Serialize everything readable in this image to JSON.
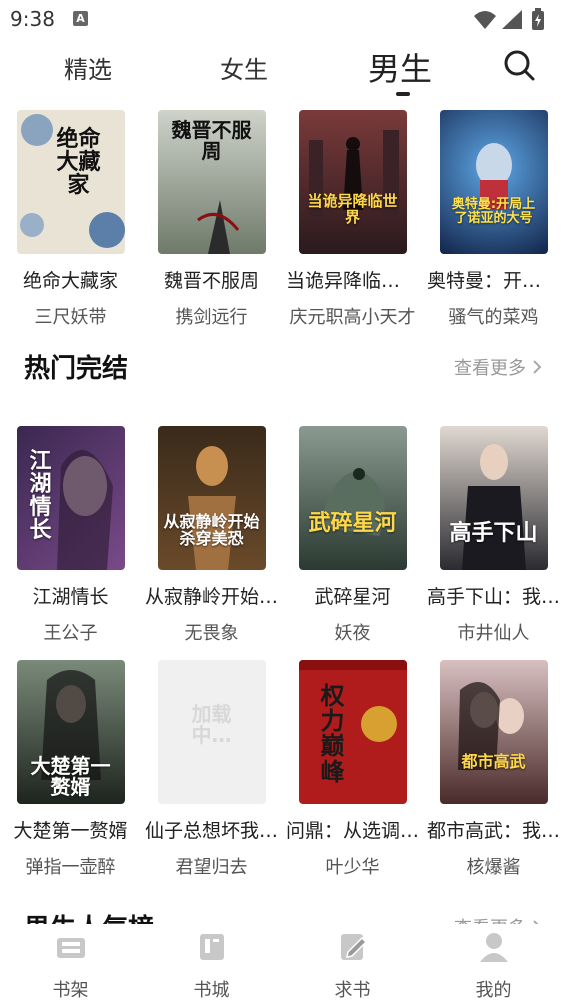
{
  "status_bar": {
    "time": "9:38",
    "notification_icon": "A"
  },
  "top_tabs": [
    {
      "label": "精选"
    },
    {
      "label": "女生"
    },
    {
      "label": "男生"
    }
  ],
  "featured_row": [
    {
      "title": "绝命大藏家",
      "author": "三尺妖带",
      "cover_text": "绝命大藏家",
      "cover_color": "#e8e2d4"
    },
    {
      "title": "魏晋不服周",
      "author": "携剑远行",
      "cover_text": "魏晋不服周",
      "cover_color": "#8a8f86"
    },
    {
      "title": "当诡异降临世界…",
      "author": "庆元职高小天才",
      "cover_text": "当诡异降临世界",
      "cover_color": "#4a2a2e"
    },
    {
      "title": "奥特曼：开局上…",
      "author": "骚气的菜鸡",
      "cover_text": "奥特曼:开局上了诺亚的大号",
      "cover_color": "#1f3d7a"
    }
  ],
  "section_hot": {
    "title": "热门完结",
    "more": "查看更多",
    "books": [
      {
        "title": "江湖情长",
        "author": "王公子",
        "cover_text": "江湖情长",
        "cover_color": "#3b2d4a"
      },
      {
        "title": "从寂静岭开始…",
        "author": "无畏象",
        "cover_text": "从寂静岭开始杀穿美恐",
        "cover_color": "#4a3424"
      },
      {
        "title": "武碎星河",
        "author": "妖夜",
        "cover_text": "武碎星河",
        "cover_color": "#3f5048"
      },
      {
        "title": "高手下山：我…",
        "author": "市井仙人",
        "cover_text": "高手下山",
        "cover_color": "#2a2a30"
      },
      {
        "title": "大楚第一赘婿",
        "author": "弹指一壶醉",
        "cover_text": "大楚第一赘婿",
        "cover_color": "#2e3530"
      },
      {
        "title": "仙子总想坏我…",
        "author": "君望归去",
        "cover_text": "加载中…",
        "cover_color": "#f0f0f0"
      },
      {
        "title": "问鼎：从选调…",
        "author": "叶少华",
        "cover_text": "权力巅峰",
        "cover_color": "#b01c1c"
      },
      {
        "title": "都市高武：我…",
        "author": "核爆酱",
        "cover_text": "都市高武",
        "cover_color": "#6a4a4a"
      }
    ]
  },
  "section_popular": {
    "title": "男生人气榜",
    "more": "查看更多"
  },
  "bottom_nav": [
    {
      "label": "书架",
      "icon": "bookshelf-icon"
    },
    {
      "label": "书城",
      "icon": "bookstore-icon"
    },
    {
      "label": "求书",
      "icon": "request-book-icon"
    },
    {
      "label": "我的",
      "icon": "profile-icon"
    }
  ]
}
